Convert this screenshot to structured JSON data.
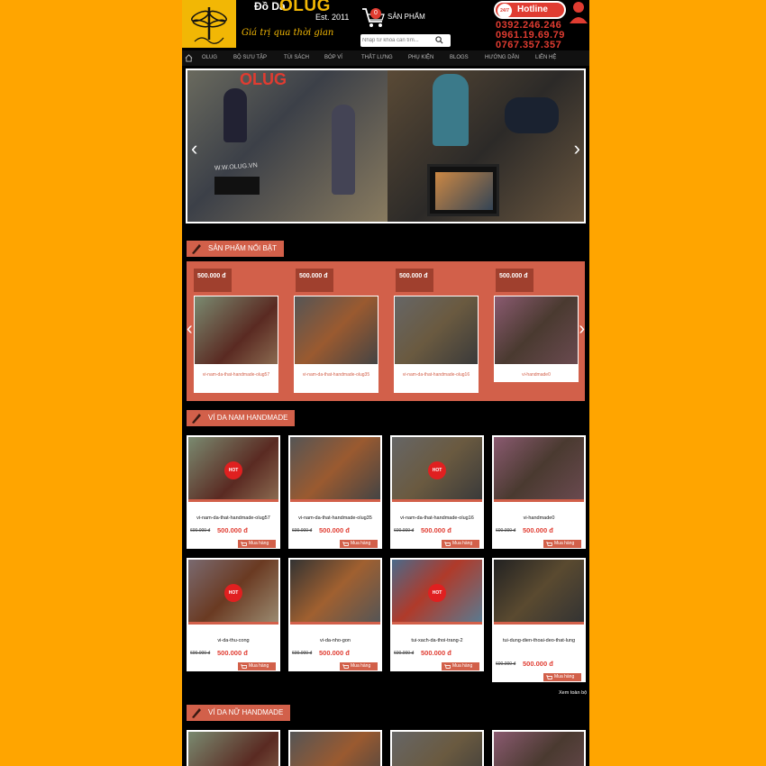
{
  "header": {
    "brand_line1": "Đồ Da",
    "brand_name": "OLUG",
    "brand_est": "Est. 2011",
    "brand_slogan": "Giá trị qua thời gian",
    "cart_count": "0",
    "cart_label": "SẢN PHẨM",
    "search_placeholder": "Nhập từ khóa cần tìm...",
    "hotline_label": "Hotline",
    "hotline_247": "24/7",
    "phones": [
      "0392.246.246",
      "0961.19.69.79",
      "0767.357.357"
    ]
  },
  "nav": [
    "OLUG",
    "BỘ SƯU TẬP",
    "TÚI SÁCH",
    "BÓP VÍ",
    "THẮT LƯNG",
    "PHỤ KIỆN",
    "BLOGS",
    "HƯỚNG DẪN",
    "LIÊN HỆ"
  ],
  "slider": {
    "shop_sign": "OLUG",
    "storefront_text": "W.W.OLUG.VN"
  },
  "featured": {
    "title": "SẢN PHẨM NỔI BẬT",
    "items": [
      {
        "price": "500.000 đ",
        "name": "vi-nam-da-that-handmade-olug57"
      },
      {
        "price": "500.000 đ",
        "name": "vi-nam-da-that-handmade-olug35"
      },
      {
        "price": "500.000 đ",
        "name": "vi-nam-da-that-handmade-olug16"
      },
      {
        "price": "500.000 đ",
        "name": "vi-handmade0"
      }
    ]
  },
  "men": {
    "title": "VÍ DA NAM HANDMADE",
    "hot_label": "HOT",
    "buy_label": "Mua hàng",
    "items": [
      {
        "name": "vi-nam-da-that-handmade-olug57",
        "old_price": "600.000 đ",
        "price": "500.000 đ"
      },
      {
        "name": "vi-nam-da-that-handmade-olug35",
        "old_price": "600.000 đ",
        "price": "500.000 đ"
      },
      {
        "name": "vi-nam-da-that-handmade-olug16",
        "old_price": "600.000 đ",
        "price": "500.000 đ"
      },
      {
        "name": "vi-handmade0",
        "old_price": "600.000 đ",
        "price": "500.000 đ"
      },
      {
        "name": "vi-da-thu-cong",
        "old_price": "600.000 đ",
        "price": "500.000 đ"
      },
      {
        "name": "vi-da-nho-gon",
        "old_price": "600.000 đ",
        "price": "500.000 đ"
      },
      {
        "name": "tui-xach-da-thoi-trang-2",
        "old_price": "600.000 đ",
        "price": "500.000 đ"
      },
      {
        "name": "tui-dung-dien-thoai-deo-that-lung",
        "old_price": "600.000 đ",
        "price": "500.000 đ"
      }
    ],
    "view_all": "Xem toàn bộ"
  },
  "women": {
    "title": "VÍ DA NỮ HANDMADE"
  }
}
